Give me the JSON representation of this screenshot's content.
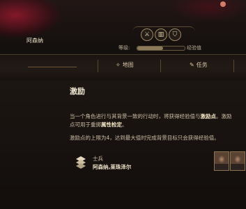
{
  "header": {
    "character_name": "阿森纳",
    "icons": [
      "swords-icon",
      "book-icon",
      "shield-icon"
    ],
    "slider": {
      "label": "等级:",
      "value_label": "经验值",
      "fill_fraction": 0.55
    }
  },
  "tabs": [
    {
      "icon": "compass-icon",
      "glyph": "✧",
      "label": "地图"
    },
    {
      "icon": "quill-icon",
      "glyph": "✎",
      "label": "任务"
    }
  ],
  "entry": {
    "title": "激励",
    "para1_a": "当一个角色进行与其背景一致的行动时，将获得经验值与",
    "para1_b": "激励点",
    "para1_c": "。激励点可用于重掷",
    "para1_d": "属性检定",
    "para1_e": "。",
    "para2": "激励点的上限为4，达到最大值时完成背景目标只会获得经验值。",
    "source_title": "士兵",
    "source_name": "阿森纳,莱珠泽尔"
  }
}
